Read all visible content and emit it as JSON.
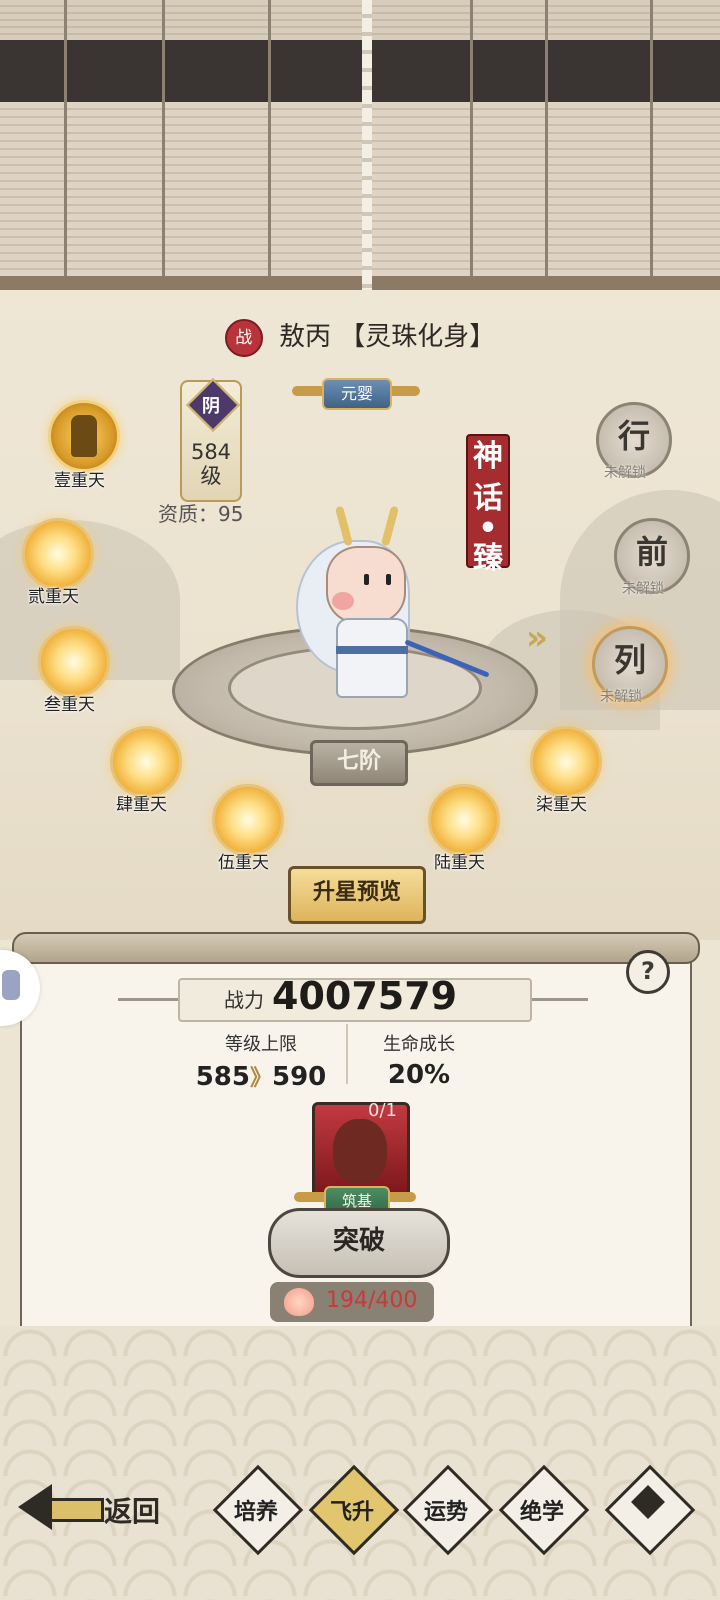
{
  "hero": {
    "faction_badge": "战",
    "name": "敖丙",
    "form": "【灵珠化身】",
    "realm": "元婴",
    "element": "阴",
    "level_line1": "584",
    "level_line2": "级",
    "aptitude": "资质：95",
    "rarity_chars": [
      "神",
      "话",
      "•",
      "臻"
    ],
    "stage": "七阶"
  },
  "star_nodes": [
    {
      "label": "壹重天"
    },
    {
      "label": "贰重天"
    },
    {
      "label": "叁重天"
    },
    {
      "label": "肆重天"
    },
    {
      "label": "伍重天"
    },
    {
      "label": "陆重天"
    },
    {
      "label": "柒重天"
    }
  ],
  "locked_nodes": [
    {
      "char": "行",
      "status": "未解锁"
    },
    {
      "char": "前",
      "status": "未解锁"
    },
    {
      "char": "列",
      "status": "未解锁"
    }
  ],
  "upgrade_preview_label": "升星预览",
  "panel": {
    "help_label": "?",
    "power_label": "战力",
    "power_value": "4007579",
    "level_cap_title": "等级上限",
    "level_cap_from": "585",
    "level_cap_sep": "》",
    "level_cap_to": "590",
    "hp_growth_title": "生命成长",
    "hp_growth_value": "20%",
    "token_count": "0/1",
    "token_realm": "筑基",
    "breakthrough_label": "突破",
    "peach_progress": "194/400"
  },
  "nav": {
    "back_label": "返回",
    "tabs": [
      {
        "label": "培养",
        "active": false
      },
      {
        "label": "飞升",
        "active": true
      },
      {
        "label": "运势",
        "active": false
      },
      {
        "label": "绝学",
        "active": false
      }
    ]
  },
  "colors": {
    "accent_gold": "#deb45c",
    "rarity_red": "#a52d2f",
    "panel_bg": "#f8f4ec"
  }
}
